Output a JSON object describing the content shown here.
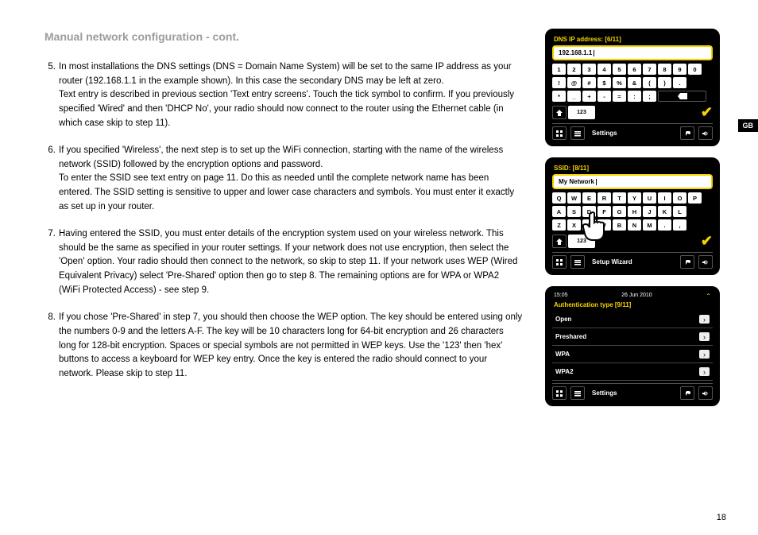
{
  "page": {
    "title": "Manual network configuration - cont.",
    "number": "18",
    "lang_tab": "GB"
  },
  "steps": {
    "s5_num": "5.",
    "s5a": "In most installations the DNS settings (DNS = Domain Name System) will be set to the same IP address as your router (192.168.1.1 in the example shown). In this case the secondary DNS may be left at zero.",
    "s5b": "Text entry is described in previous section 'Text entry screens'. Touch the tick symbol to confirm. If you previously specified 'Wired' and then 'DHCP No', your radio should now connect to the router using the Ethernet cable (in which case skip to step 11).",
    "s6_num": "6.",
    "s6a": "If you specified 'Wireless', the next step is to set up the WiFi connection, starting with the name of the wireless network (SSID) followed by the encryption options and password.",
    "s6b": "To enter the SSID see text entry on page 11. Do this as needed until the complete network name has been entered. The SSID setting is sensitive to upper and lower case characters and symbols. You must enter it exactly as set up in your router.",
    "s7_num": "7.",
    "s7": "Having entered the SSID, you must enter details of the encryption system used on your wireless network. This should be the same as specified in your router settings. If your network does not use encryption, then select the 'Open' option. Your radio should then connect to the network, so skip to step 11. If your network uses WEP (Wired Equivalent Privacy) select 'Pre-Shared' option then go to step 8. The remaining options are for WPA or WPA2 (WiFi Protected Access) - see step 9.",
    "s8_num": "8.",
    "s8": "If you chose 'Pre-Shared' in step 7, you should then choose the WEP option. The key should be entered using only the numbers 0-9 and the letters A-F. The key will be 10 characters long for 64-bit encryption and 26 characters long for 128-bit encryption. Spaces or special symbols are not permitted in WEP keys. Use the '123' then 'hex' buttons to access a keyboard for WEP key entry. Once the key is entered the radio should connect to your network. Please skip to step 11."
  },
  "screen1": {
    "title": "DNS IP address: [6/11]",
    "input": "192.168.1.1",
    "row1": [
      "1",
      "2",
      "3",
      "4",
      "5",
      "6",
      "7",
      "8",
      "9",
      "0"
    ],
    "row2": [
      "!",
      "@",
      "#",
      "$",
      "%",
      "&",
      "(",
      ")",
      "."
    ],
    "row3": [
      "*",
      "_",
      "+",
      "-",
      "=",
      ":",
      ";"
    ],
    "mode": "123",
    "footer": "Settings"
  },
  "screen2": {
    "title": "SSID: [8/11]",
    "input": "My Network",
    "row1": [
      "Q",
      "W",
      "E",
      "R",
      "T",
      "Y",
      "U",
      "I",
      "O",
      "P"
    ],
    "row2": [
      "A",
      "S",
      "D",
      "F",
      "G",
      "H",
      "J",
      "K",
      "L"
    ],
    "row3": [
      "Z",
      "X",
      "C",
      "V",
      "B",
      "N",
      "M",
      ".",
      ","
    ],
    "mode": "123",
    "footer": "Setup Wizard"
  },
  "screen3": {
    "time": "15:05",
    "date": "26 Jun 2010",
    "title": "Authentication type [9/11]",
    "opt1": "Open",
    "opt2": "Preshared",
    "opt3": "WPA",
    "opt4": "WPA2",
    "footer": "Settings"
  }
}
